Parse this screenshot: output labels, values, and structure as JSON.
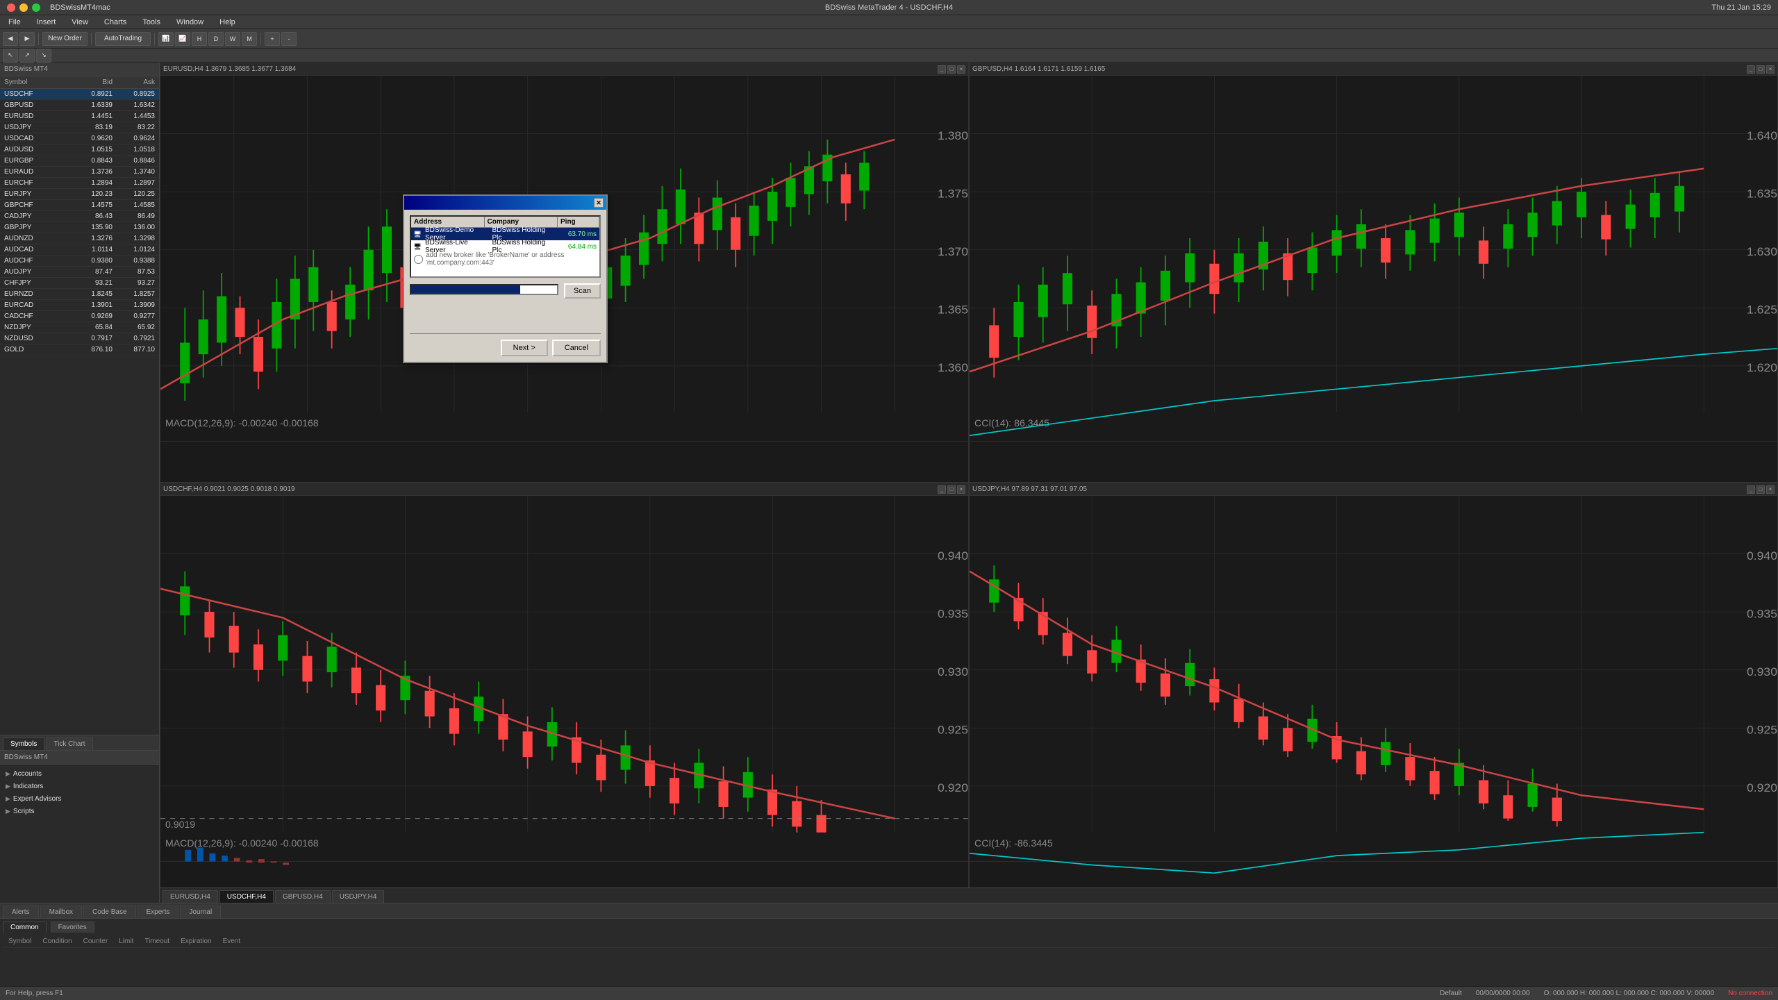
{
  "app": {
    "title": "BDSwiss MetaTrader 4 - USDCHF,H4",
    "window_title": "BDSwissMT4mac"
  },
  "mac_titlebar": {
    "title": "BDSwiss MetaTrader 4 - USDCHF,H4",
    "time": "Thu 21 Jan 15:29"
  },
  "menu": {
    "items": [
      "File",
      "Insert",
      "View",
      "Charts",
      "Tools",
      "Window",
      "Help"
    ]
  },
  "toolbar": {
    "new_order": "New Order",
    "autotrading": "AutoTrading"
  },
  "market_watch": {
    "header": "BDSwiss MT4",
    "columns": {
      "symbol": "Symbol",
      "bid": "Bid",
      "ask": "Ask"
    },
    "rows": [
      {
        "symbol": "USDCHF",
        "bid": "0.8921",
        "ask": "0.8925",
        "selected": true
      },
      {
        "symbol": "GBPUSD",
        "bid": "1.6339",
        "ask": "1.6342"
      },
      {
        "symbol": "EURUSD",
        "bid": "1.4451",
        "ask": "1.4453"
      },
      {
        "symbol": "USDJPY",
        "bid": "83.19",
        "ask": "83.22"
      },
      {
        "symbol": "USDCAD",
        "bid": "0.9620",
        "ask": "0.9624"
      },
      {
        "symbol": "AUDUSD",
        "bid": "1.0515",
        "ask": "1.0518"
      },
      {
        "symbol": "EURGBP",
        "bid": "0.8843",
        "ask": "0.8846"
      },
      {
        "symbol": "EURAUD",
        "bid": "1.3736",
        "ask": "1.3740"
      },
      {
        "symbol": "EURCHF",
        "bid": "1.2894",
        "ask": "1.2897"
      },
      {
        "symbol": "EURJPY",
        "bid": "120.23",
        "ask": "120.25"
      },
      {
        "symbol": "GBPCHF",
        "bid": "1.4575",
        "ask": "1.4585"
      },
      {
        "symbol": "CADJPY",
        "bid": "86.43",
        "ask": "86.49"
      },
      {
        "symbol": "GBPJPY",
        "bid": "135.90",
        "ask": "136.00"
      },
      {
        "symbol": "AUDNZD",
        "bid": "1.3276",
        "ask": "1.3298"
      },
      {
        "symbol": "AUDCAD",
        "bid": "1.0114",
        "ask": "1.0124"
      },
      {
        "symbol": "AUDCHF",
        "bid": "0.9380",
        "ask": "0.9388"
      },
      {
        "symbol": "AUDJPY",
        "bid": "87.47",
        "ask": "87.53"
      },
      {
        "symbol": "CHFJPY",
        "bid": "93.21",
        "ask": "93.27"
      },
      {
        "symbol": "EURNZD",
        "bid": "1.8245",
        "ask": "1.8257"
      },
      {
        "symbol": "EURCAD",
        "bid": "1.3901",
        "ask": "1.3909"
      },
      {
        "symbol": "CADCHF",
        "bid": "0.9269",
        "ask": "0.9277"
      },
      {
        "symbol": "NZDJPY",
        "bid": "65.84",
        "ask": "65.92"
      },
      {
        "symbol": "NZDUSD",
        "bid": "0.7917",
        "ask": "0.7921"
      },
      {
        "symbol": "GOLD",
        "bid": "876.10",
        "ask": "877.10"
      }
    ],
    "tabs": [
      "Symbols",
      "Tick Chart"
    ]
  },
  "navigator": {
    "header": "BDSwiss MT4",
    "items": [
      {
        "label": "Accounts",
        "icon": "▶",
        "indent": false
      },
      {
        "label": "Indicators",
        "icon": "▶",
        "indent": false
      },
      {
        "label": "Expert Advisors",
        "icon": "▶",
        "indent": false
      },
      {
        "label": "Scripts",
        "icon": "▶",
        "indent": false
      }
    ]
  },
  "charts": [
    {
      "id": "eurusd",
      "title": "EURUSD,H4",
      "info": "EURUSD,H4 1.3679 1.3685 1.3677 1.3684"
    },
    {
      "id": "gbpusd",
      "title": "GBPUSD,H4",
      "info": "GBPUSD,H4 1.6164 1.6171 1.6159 1.6165"
    },
    {
      "id": "usdchf",
      "title": "USDCHF,H4",
      "info": "USDCHF,H4 0.9021 0.9025 0.9018 0.9019"
    },
    {
      "id": "usdjpy",
      "title": "USDJPY,H4",
      "info": "USDJPY,H4 97.89 97.31 97.01 97.05"
    }
  ],
  "chart_tabs": [
    {
      "label": "EURUSD,H4",
      "active": false
    },
    {
      "label": "USDCHF,H4",
      "active": true
    },
    {
      "label": "GBPUSD,H4",
      "active": false
    },
    {
      "label": "USDJPY,H4",
      "active": false
    }
  ],
  "bottom_panel": {
    "tabs": [
      "Alerts",
      "Mailbox",
      "Code Base",
      "Experts",
      "Journal"
    ],
    "active_tab": "Common",
    "columns": [
      "Symbol",
      "Condition",
      "Counter",
      "Limit",
      "Timeout",
      "Expiration",
      "Event"
    ]
  },
  "bottom_tabs_secondary": [
    "Common",
    "Favorites"
  ],
  "dialog": {
    "title": "",
    "list_headers": {
      "address": "Address",
      "company": "Company",
      "ping": "Ping"
    },
    "servers": [
      {
        "icon": "🖥",
        "address": "BDSwiss-Demo Server",
        "company": "BDSwiss Holding Plc",
        "ping": "63.70 ms",
        "selected": true
      },
      {
        "icon": "🖥",
        "address": "BDSwiss-Live Server",
        "company": "BDSwiss Holding Plc",
        "ping": "64.84 ms",
        "selected": false
      }
    ],
    "add_server_text": "add new broker like 'BrokerName' or address 'mt.company.com:443'",
    "progress": 75,
    "scan_button": "Scan",
    "next_button": "Next >",
    "cancel_button": "Cancel"
  },
  "status_bar": {
    "left": "For Help, press F1",
    "profile": "Default",
    "datetime": "00/00/0000 00:00",
    "ohlc": "O: 000.000  H: 000.000  L: 000.000  C: 000.000  V: 00000",
    "connection": "No connection"
  }
}
